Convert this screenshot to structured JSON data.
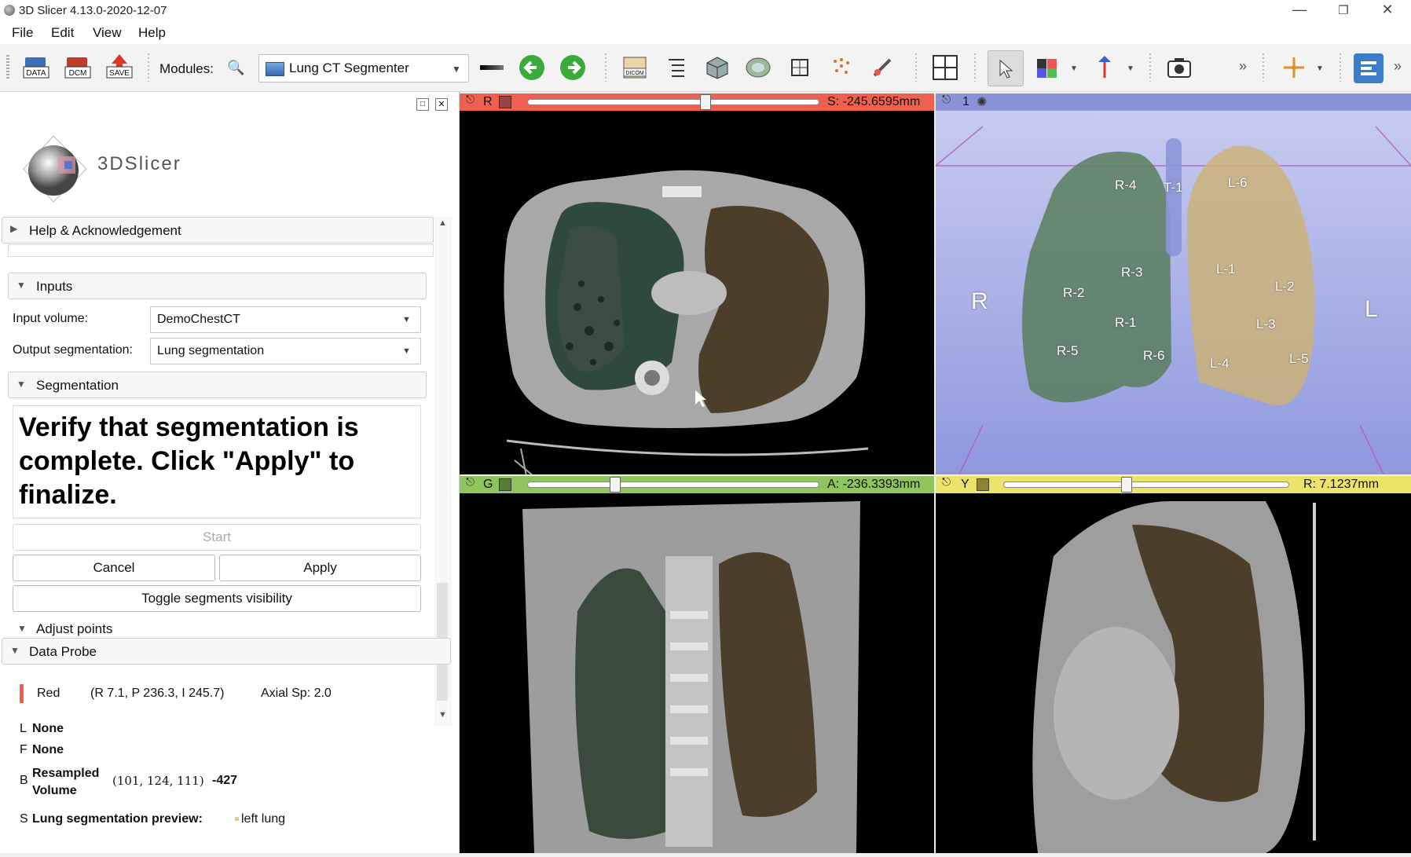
{
  "window": {
    "title": "3D Slicer 4.13.0-2020-12-07",
    "controls": [
      "minimize-icon",
      "restore-icon",
      "close-icon"
    ]
  },
  "menu": [
    "File",
    "Edit",
    "View",
    "Help"
  ],
  "toolbar": {
    "icons_left": [
      "data-icon",
      "dcm-icon",
      "save-icon"
    ],
    "labels": {
      "data": "DATA",
      "dcm": "DCM",
      "save": "SAVE"
    },
    "modules_label": "Modules:",
    "module_selected": "Lung CT Segmenter"
  },
  "panel": {
    "logo_text": "3DSlicer",
    "help_section": "Help & Acknowledgement",
    "inputs_section": "Inputs",
    "input_volume_label": "Input volume:",
    "input_volume_value": "DemoChestCT",
    "output_seg_label": "Output segmentation:",
    "output_seg_value": "Lung segmentation",
    "segmentation_section": "Segmentation",
    "instruction": "Verify that segmentation is complete. Click \"Apply\" to finalize.",
    "start_button": "Start",
    "cancel_button": "Cancel",
    "apply_button": "Apply",
    "toggle_button": "Toggle segments visibility",
    "adjust_points_section": "Adjust points",
    "data_probe_section": "Data Probe",
    "probe": {
      "view_name": "Red",
      "coords": "(R 7.1, P 236.3, I 245.7)",
      "spacing": "Axial Sp: 2.0",
      "rows": [
        {
          "key": "L",
          "name": "None",
          "extra": "",
          "value": ""
        },
        {
          "key": "F",
          "name": "None",
          "extra": "",
          "value": ""
        },
        {
          "key": "B",
          "name": "Resampled Volume",
          "extra": "(101, 124, 111)",
          "value": "-427"
        },
        {
          "key": "S",
          "name": "Lung segmentation preview:",
          "extra": "left lung",
          "value": ""
        }
      ]
    }
  },
  "views": {
    "red": {
      "letter": "R",
      "readout": "S: -245.6595mm",
      "color": "#ee6150",
      "slider_fraction": 0.61
    },
    "threeD": {
      "letter": "1",
      "color": "#8a93d8",
      "orient_left": "R",
      "orient_right": "L",
      "labels": [
        "R-4",
        "T-1",
        "L-6",
        "R-3",
        "R-2",
        "L-1",
        "L-2",
        "R-1",
        "L-3",
        "R-5",
        "R-6",
        "L-4",
        "L-5"
      ]
    },
    "green": {
      "letter": "G",
      "readout": "A: -236.3393mm",
      "color": "#8fc45e",
      "slider_fraction": 0.3
    },
    "yellow": {
      "letter": "Y",
      "readout": "R: 7.1237mm",
      "color": "#ece36a",
      "slider_fraction": 0.43
    }
  }
}
